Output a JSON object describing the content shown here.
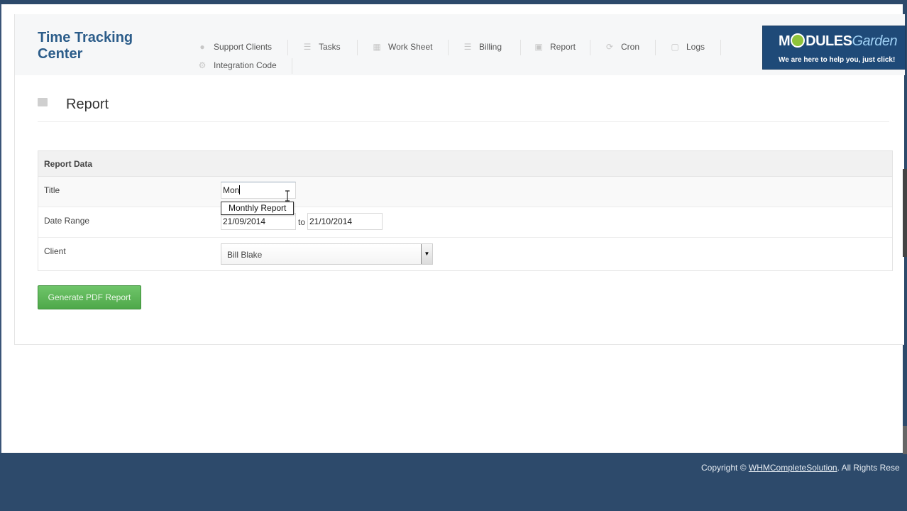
{
  "app": {
    "title": "Time Tracking Center"
  },
  "nav": {
    "items": [
      {
        "label": "Support Clients",
        "icon": "user-icon"
      },
      {
        "label": "Tasks",
        "icon": "list-icon"
      },
      {
        "label": "Work Sheet",
        "icon": "calendar-icon"
      },
      {
        "label": "Billing",
        "icon": "billing-list-icon"
      },
      {
        "label": "Report",
        "icon": "book-icon"
      },
      {
        "label": "Cron",
        "icon": "refresh-icon"
      },
      {
        "label": "Logs",
        "icon": "log-window-icon"
      },
      {
        "label": "Integration Code",
        "icon": "gears-icon"
      }
    ]
  },
  "logo": {
    "brand_a": "M",
    "brand_b": "DULES",
    "brand_c": "Garden",
    "tagline": "We are here to help you, just click!"
  },
  "page": {
    "title": "Report"
  },
  "form": {
    "section_title": "Report Data",
    "title_label": "Title",
    "title_value": "Mon",
    "autocomplete_suggestion": "Monthly Report",
    "date_label": "Date Range",
    "date_from": "21/09/2014",
    "date_to_label": "to",
    "date_to": "21/10/2014",
    "client_label": "Client",
    "client_value": "Bill Blake"
  },
  "actions": {
    "generate_label": "Generate PDF Report"
  },
  "footer": {
    "prefix": "Copyright © ",
    "link": "WHMCompleteSolution",
    "suffix": ". All Rights Rese"
  },
  "colors": {
    "accent": "#2c5d8a",
    "button_green": "#5cb85c",
    "footer_bg": "#2d4a6b"
  }
}
